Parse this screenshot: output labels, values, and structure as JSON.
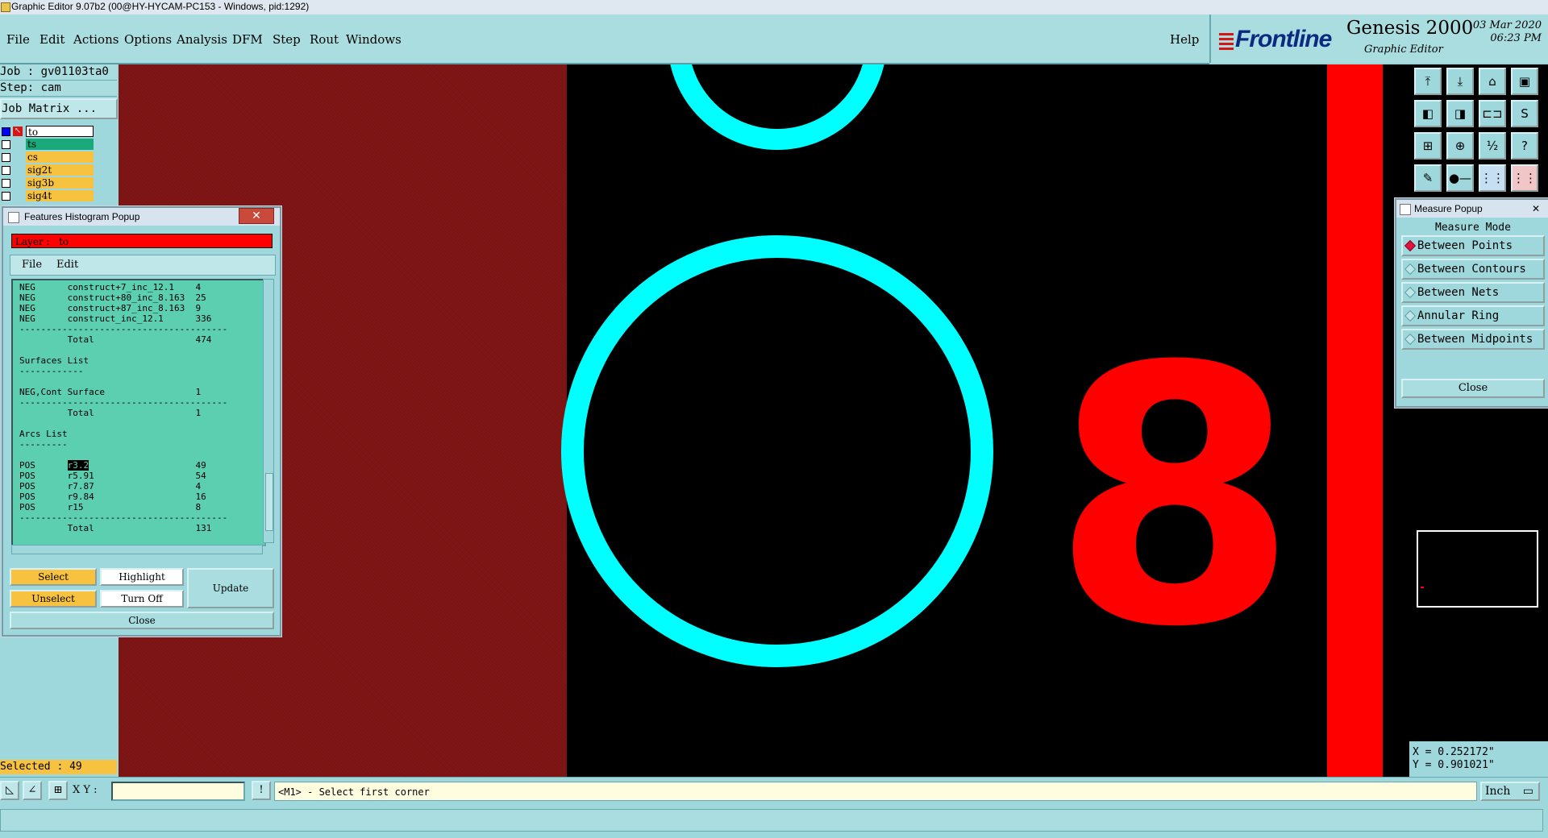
{
  "window": {
    "title": "Graphic Editor 9.07b2 (00@HY-HYCAM-PC153 - Windows, pid:1292)"
  },
  "menu": [
    {
      "label": "File"
    },
    {
      "label": "Edit"
    },
    {
      "label": "Actions"
    },
    {
      "label": "Options"
    },
    {
      "label": "Analysis"
    },
    {
      "label": "DFM"
    },
    {
      "label": "Step"
    },
    {
      "label": "Rout"
    },
    {
      "label": "Windows"
    }
  ],
  "help_label": "Help",
  "brand": {
    "logo": "Frontline",
    "product": "Genesis 2000",
    "subtitle": "Graphic Editor",
    "date": "03 Mar 2020",
    "time": "06:23 PM"
  },
  "left": {
    "job": "Job : gv01103ta0",
    "step": "Step: cam",
    "job_matrix": "Job Matrix ...",
    "layers": [
      {
        "name": "to",
        "checked": true,
        "work": true
      },
      {
        "name": "ts",
        "checked": false,
        "work": false
      },
      {
        "name": "cs",
        "checked": false,
        "work": false
      },
      {
        "name": "sig2t",
        "checked": false,
        "work": false
      },
      {
        "name": "sig3b",
        "checked": false,
        "work": false
      },
      {
        "name": "sig4t",
        "checked": false,
        "work": false
      }
    ],
    "selected": "Selected : 49"
  },
  "histogram": {
    "title": "Features Histogram Popup",
    "close_x": "✕",
    "layer_label": "Layer :",
    "layer_value": "to",
    "file_menu": "File",
    "edit_menu": "Edit",
    "lines": [
      "NEG      construct+7_inc_12.1    4",
      "NEG      construct+80_inc_8.163  25",
      "NEG      construct+87_inc_8.163  9",
      "NEG      construct_inc_12.1      336",
      "---------------------------------------",
      "         Total                   474",
      "",
      "Surfaces List",
      "------------",
      "",
      "NEG,Cont Surface                 1",
      "---------------------------------------",
      "         Total                   1",
      "",
      "Arcs List",
      "---------",
      "",
      "POS      r3.2                    49",
      "POS      r5.91                   54",
      "POS      r7.87                   4",
      "POS      r9.84                   16",
      "POS      r15                     8",
      "---------------------------------------",
      "         Total                   131"
    ],
    "buttons": {
      "select": "Select",
      "highlight": "Highlight",
      "update": "Update",
      "unselect": "Unselect",
      "turn_off": "Turn Off",
      "close": "Close"
    }
  },
  "measure": {
    "title": "Measure Popup",
    "close_x": "✕",
    "mode_title": "Measure Mode",
    "options": [
      {
        "label": "Between Points",
        "selected": true
      },
      {
        "label": "Between Contours",
        "selected": false
      },
      {
        "label": "Between Nets",
        "selected": false
      },
      {
        "label": "Annular Ring",
        "selected": false
      },
      {
        "label": "Between Midpoints",
        "selected": false
      }
    ],
    "close_label": "Close"
  },
  "coords": {
    "x": "X = 0.252172\"",
    "y": "Y = 0.901021\""
  },
  "bottom": {
    "xy_label": "X Y :",
    "xy_value": "",
    "message": "<M1> - Select first corner",
    "unit": "Inch"
  },
  "canvas": {
    "text_feature": "8",
    "colors": {
      "copper": "#801515",
      "ring": "#00ffff",
      "red": "#ff0000"
    }
  },
  "icons": [
    "pin-top-icon",
    "pin-bottom-icon",
    "home-icon",
    "layout-icon",
    "pan-left-icon",
    "pan-right-icon",
    "fit-icon",
    "snap-icon",
    "zoom-fit-icon",
    "zoom-in-icon",
    "scale-1-2-icon",
    "help-icon",
    "tools-icon",
    "route-icon",
    "net-icon",
    "net-red-icon"
  ]
}
